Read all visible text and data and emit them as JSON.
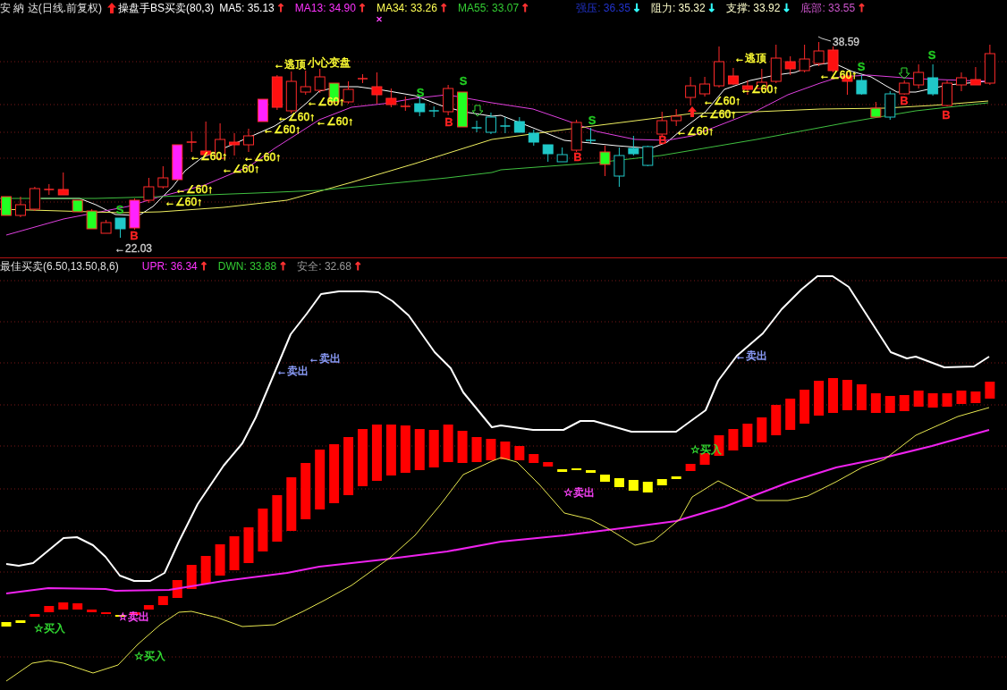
{
  "price_panel": {
    "title": "安 納 达(日线.前复权)",
    "indicator": "操盘手BS买卖(80,3)",
    "moving_averages": [
      {
        "label": "MA5: 35.13",
        "color": "#ffffff",
        "arrow": {
          "text": "↑",
          "color": "#ff3333"
        }
      },
      {
        "label": "MA13: 34.90",
        "color": "#ff33ff",
        "arrow": {
          "text": "↑",
          "color": "#ff3333"
        }
      },
      {
        "label": "MA34: 33.26",
        "color": "#ffff55",
        "arrow": {
          "text": "↑",
          "color": "#ff3333"
        }
      },
      {
        "label": "MA55: 33.07",
        "color": "#33cc33",
        "arrow": {
          "text": "↑",
          "color": "#ff3333"
        }
      }
    ],
    "levels": [
      {
        "label": "强压: 36.35",
        "color": "#2233cc",
        "arrow": {
          "text": "↓",
          "color": "#33ffff"
        }
      },
      {
        "label": "阻力: 35.32",
        "color": "#ffffcc",
        "arrow": {
          "text": "↓",
          "color": "#33ffff"
        }
      },
      {
        "label": "支撑: 33.92",
        "color": "#ffffcc",
        "arrow": {
          "text": "↓",
          "color": "#33ffff"
        }
      },
      {
        "label": "底部: 33.55",
        "color": "#cc55cc",
        "arrow": {
          "text": "↑",
          "color": "#ff3333"
        }
      }
    ],
    "annotations": [
      {
        "kind": "signal",
        "text": "S",
        "color": "#22cc22"
      },
      {
        "kind": "signal",
        "text": "B",
        "color": "#ff2222"
      },
      {
        "kind": "price",
        "text": "←22.03",
        "color": "#d0d0d0"
      },
      {
        "kind": "note",
        "text": "←∠60↑",
        "color": "#ffff33"
      },
      {
        "kind": "note",
        "text": "←∠60↑",
        "color": "#ffff33"
      },
      {
        "kind": "note",
        "text": "←∠60↑",
        "color": "#ffff33"
      },
      {
        "kind": "note",
        "text": "←∠60↑",
        "color": "#ffff33"
      },
      {
        "kind": "note",
        "text": "←∠60↑",
        "color": "#ffff33"
      },
      {
        "kind": "note",
        "text": "←∠60↑",
        "color": "#ffff33"
      },
      {
        "kind": "note",
        "text": "←∠60↑",
        "color": "#ffff33"
      },
      {
        "kind": "note",
        "text": "←逃顶",
        "color": "#ffff33"
      },
      {
        "kind": "note",
        "text": "小心变盘",
        "color": "#ffff33"
      },
      {
        "kind": "note",
        "text": "←∠60↑",
        "color": "#ffff33"
      },
      {
        "kind": "note",
        "text": "←∠60↑",
        "color": "#ffff33"
      },
      {
        "kind": "signal",
        "text": "S",
        "color": "#22cc22"
      },
      {
        "kind": "signal",
        "text": "B",
        "color": "#ff2222"
      },
      {
        "kind": "signal",
        "text": "S",
        "color": "#22cc22"
      },
      {
        "kind": "signal",
        "text": "B",
        "color": "#ff2222"
      },
      {
        "kind": "signal",
        "text": "S",
        "color": "#22cc22"
      },
      {
        "kind": "signal",
        "text": "B",
        "color": "#ff2222"
      },
      {
        "kind": "note",
        "text": "←∠60↑",
        "color": "#ffff33"
      },
      {
        "kind": "note",
        "text": "←∠60↑",
        "color": "#ffff33"
      },
      {
        "kind": "note",
        "text": "←∠60↑",
        "color": "#ffff33"
      },
      {
        "kind": "note",
        "text": "←∠60↑",
        "color": "#ffff33"
      },
      {
        "kind": "note",
        "text": "←逃顶",
        "color": "#ffff33"
      },
      {
        "kind": "note",
        "text": "←∠60↑",
        "color": "#ffff33"
      },
      {
        "kind": "peak",
        "text": "38.59",
        "color": "#d0d0d0"
      },
      {
        "kind": "signal",
        "text": "S",
        "color": "#22cc22"
      },
      {
        "kind": "signal",
        "text": "B",
        "color": "#ff2222"
      },
      {
        "kind": "signal",
        "text": "S",
        "color": "#22cc22"
      },
      {
        "kind": "signal",
        "text": "B",
        "color": "#ff2222"
      }
    ]
  },
  "indicator_panel": {
    "title": "最佳买卖(6.50,13.50,8,6)",
    "readings": [
      {
        "label": "UPR: 36.34",
        "color": "#ff33ff",
        "arrow": {
          "text": "↑",
          "color": "#ff3333"
        }
      },
      {
        "label": "DWN: 33.88",
        "color": "#33cc33",
        "arrow": {
          "text": "↑",
          "color": "#ff3333"
        }
      },
      {
        "label": "安全: 32.68",
        "color": "#999999",
        "arrow": {
          "text": "↑",
          "color": "#ff3333"
        }
      }
    ],
    "annotations": [
      {
        "text": "☆买入",
        "color": "#33dd33"
      },
      {
        "text": "☆卖出",
        "color": "#ff44ff"
      },
      {
        "text": "☆买入",
        "color": "#33dd33"
      },
      {
        "text": "←卖出",
        "color": "#8fa0ff"
      },
      {
        "text": "←卖出",
        "color": "#8fa0ff"
      },
      {
        "text": "☆卖出",
        "color": "#ff44ff"
      },
      {
        "text": "☆买入",
        "color": "#33dd33"
      },
      {
        "text": "←卖出",
        "color": "#8fa0ff"
      }
    ]
  }
}
